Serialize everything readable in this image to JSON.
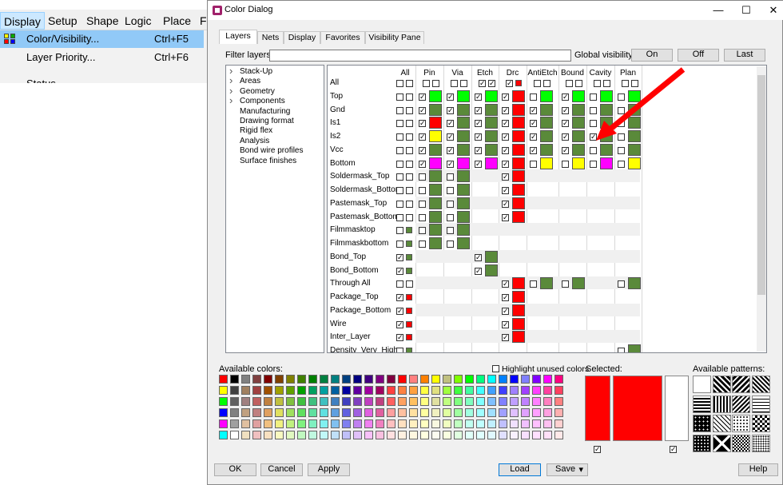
{
  "menubar": {
    "items": [
      "Display",
      "Setup",
      "Shape",
      "Logic",
      "Place",
      "Fl"
    ]
  },
  "display_menu": {
    "items": [
      {
        "label": "Color/Visibility...",
        "shortcut": "Ctrl+F5"
      },
      {
        "label": "Layer Priority...",
        "shortcut": "Ctrl+F6"
      },
      {
        "label": "Status",
        "shortcut": ""
      }
    ]
  },
  "dialog": {
    "title": "Color Dialog",
    "minimize": "—",
    "maximize": "☐",
    "close": "✕"
  },
  "tabs": [
    "Layers",
    "Nets",
    "Display",
    "Favorites",
    "Visibility Pane"
  ],
  "filter": {
    "label": "Filter layers:",
    "value": ""
  },
  "global_visibility": {
    "label": "Global visibility:",
    "on": "On",
    "off": "Off",
    "last": "Last"
  },
  "tree": [
    {
      "label": "Stack-Up",
      "expandable": true
    },
    {
      "label": "Areas",
      "expandable": true
    },
    {
      "label": "Geometry",
      "expandable": true
    },
    {
      "label": "Components",
      "expandable": true
    },
    {
      "label": "Manufacturing",
      "expandable": false
    },
    {
      "label": "Drawing format",
      "expandable": false
    },
    {
      "label": "Rigid flex",
      "expandable": false
    },
    {
      "label": "Analysis",
      "expandable": false
    },
    {
      "label": "Bond wire profiles",
      "expandable": false
    },
    {
      "label": "Surface finishes",
      "expandable": false
    }
  ],
  "grid": {
    "columns": [
      "All",
      "Pin",
      "Via",
      "Etch",
      "Drc",
      "AntiEtch",
      "Bound",
      "Cavity",
      "Plan"
    ],
    "rows": [
      "All",
      "Top",
      "Gnd",
      "Is1",
      "Is2",
      "Vcc",
      "Bottom",
      "Soldermask_Top",
      "Soldermask_Bottom",
      "Pastemask_Top",
      "Pastemask_Bottom",
      "Filmmasktop",
      "Filmmaskbottom",
      "Bond_Top",
      "Bond_Bottom",
      "Through All",
      "Package_Top",
      "Package_Bottom",
      "Wire",
      "Inter_Layer",
      "Density_Very_High"
    ]
  },
  "available_colors_label": "Available colors:",
  "highlight_unused": {
    "label": "Highlight unused colors",
    "checked": false
  },
  "selected_label": "Selected:",
  "available_patterns_label": "Available patterns:",
  "buttons": {
    "ok": "OK",
    "cancel": "Cancel",
    "apply": "Apply",
    "load": "Load",
    "save": "Save",
    "save_arrow": "▾",
    "help": "Help"
  },
  "colors": {
    "green": "#00ff00",
    "olive": "#5a8a3a",
    "red": "#ff0000",
    "yellow": "#ffff00",
    "magenta": "#ff00ff",
    "accent": "#0078d7",
    "annotation_arrow": "#ff0000"
  }
}
